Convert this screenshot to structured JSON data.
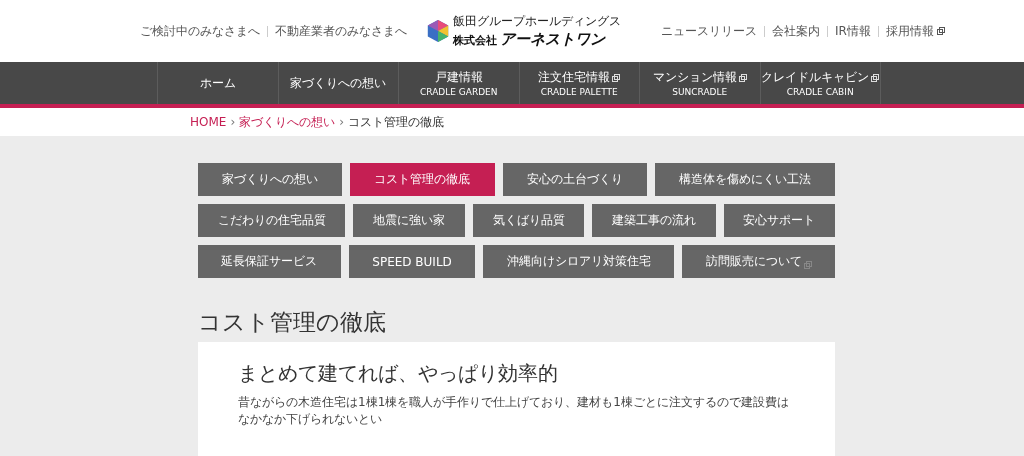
{
  "header": {
    "left_links": [
      {
        "label": "ご検討中のみなさまへ"
      },
      {
        "label": "不動産業者のみなさまへ"
      }
    ],
    "logo": {
      "group": "飯田グループホールディングス",
      "prefix": "株式会社",
      "name": "アーネストワン"
    },
    "right_links": [
      {
        "label": "ニュースリリース",
        "external": false
      },
      {
        "label": "会社案内",
        "external": false
      },
      {
        "label": "IR情報",
        "external": false
      },
      {
        "label": "採用情報",
        "external": true
      }
    ]
  },
  "nav": [
    {
      "label": "ホーム",
      "external": false
    },
    {
      "label": "家づくりへの想い",
      "external": false
    },
    {
      "label": "戸建情報",
      "sub": "CRADLE GARDEN",
      "external": false
    },
    {
      "label": "注文住宅情報",
      "sub": "CRADLE PALETTE",
      "external": true
    },
    {
      "label": "マンション情報",
      "sub": "SUNCRADLE",
      "external": true
    },
    {
      "label": "クレイドルキャビン",
      "sub": "CRADLE CABIN",
      "external": true
    }
  ],
  "breadcrumb": [
    {
      "label": "HOME",
      "link": true
    },
    {
      "sep": "›",
      "label": "家づくりへの想い",
      "link": true
    },
    {
      "sep": "›",
      "label": "コスト管理の徹底",
      "link": false
    }
  ],
  "tabs": [
    [
      {
        "label": "家づくりへの想い",
        "selected": false,
        "external": false
      },
      {
        "label": "コスト管理の徹底",
        "selected": true,
        "external": false
      },
      {
        "label": "安心の土台づくり",
        "selected": false,
        "external": false
      },
      {
        "label": "構造体を傷めにくい工法",
        "selected": false,
        "external": false
      }
    ],
    [
      {
        "label": "こだわりの住宅品質",
        "selected": false,
        "external": false
      },
      {
        "label": "地震に強い家",
        "selected": false,
        "external": false
      },
      {
        "label": "気くばり品質",
        "selected": false,
        "external": false
      },
      {
        "label": "建築工事の流れ",
        "selected": false,
        "external": false
      },
      {
        "label": "安心サポート",
        "selected": false,
        "external": false
      }
    ],
    [
      {
        "label": "延長保証サービス",
        "selected": false,
        "external": false
      },
      {
        "label": "SPEED BUILD",
        "selected": false,
        "external": false
      },
      {
        "label": "沖縄向けシロアリ対策住宅",
        "selected": false,
        "external": false
      },
      {
        "label": "訪問販売について",
        "selected": false,
        "external": true
      }
    ]
  ],
  "page_title": "コスト管理の徹底",
  "section": {
    "heading": "まとめて建てれば、やっぱり効率的",
    "body": "昔ながらの木造住宅は1棟1棟を職人が手作りで仕上げており、建材も1棟ごとに注文するので建設費はなかなか下げられないとい"
  }
}
